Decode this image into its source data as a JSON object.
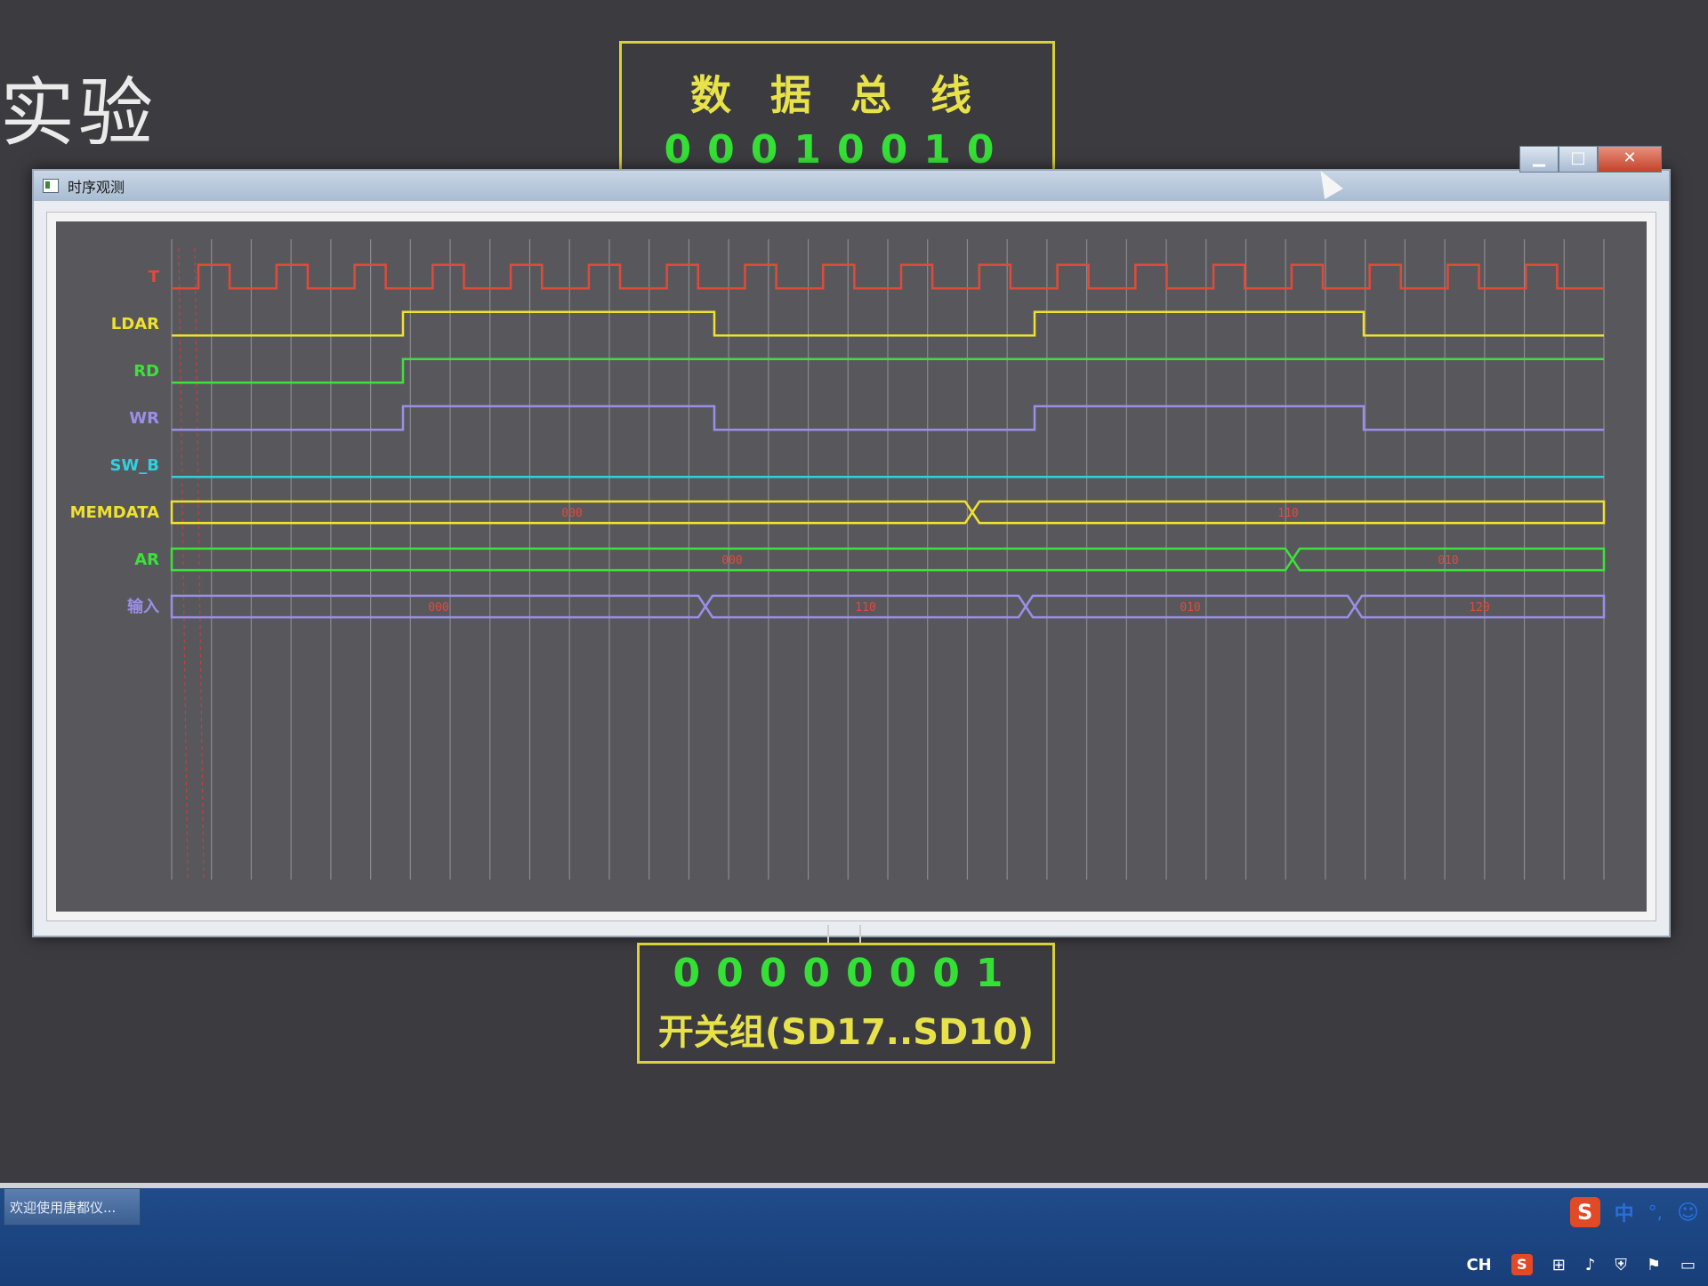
{
  "background": {
    "title": "实验",
    "bus": {
      "title": "数 据 总 线",
      "value": "00010010"
    },
    "switches": {
      "value": "00000001",
      "label": "开关组(SD17..SD10)"
    }
  },
  "window": {
    "title": "时序观测",
    "controls": {
      "minimize": "▁",
      "maximize": "□",
      "close": "✕"
    }
  },
  "signals": [
    {
      "name": "T",
      "color": "#e04a3a",
      "kind": "clock"
    },
    {
      "name": "LDAR",
      "color": "#f0e030",
      "kind": "level",
      "levels": [
        0,
        1,
        0,
        1,
        0
      ]
    },
    {
      "name": "RD",
      "color": "#3ee03a",
      "kind": "level",
      "levels": [
        0,
        1,
        1,
        1,
        1
      ]
    },
    {
      "name": "WR",
      "color": "#9a8fe8",
      "kind": "level",
      "levels": [
        0,
        1,
        0,
        1,
        0
      ]
    },
    {
      "name": "SW_B",
      "color": "#30d0e0",
      "kind": "level",
      "levels": [
        0,
        0,
        0,
        0,
        0
      ]
    },
    {
      "name": "MEMDATA",
      "color": "#f0e030",
      "kind": "bus",
      "values": [
        "000",
        "110"
      ]
    },
    {
      "name": "AR",
      "color": "#3ee03a",
      "kind": "bus",
      "values": [
        "000",
        "010"
      ]
    },
    {
      "name": "输入",
      "color": "#9a8fe8",
      "kind": "bus",
      "values": [
        "000",
        "110",
        "010",
        "120"
      ]
    }
  ],
  "taskbar": {
    "active_task": "欢迎使用唐都仪...",
    "ime": {
      "logo": "S",
      "lang": "中",
      "punct": "°,",
      "emoji": "☺"
    },
    "tray": {
      "lang": "CH",
      "logo": "S"
    }
  }
}
